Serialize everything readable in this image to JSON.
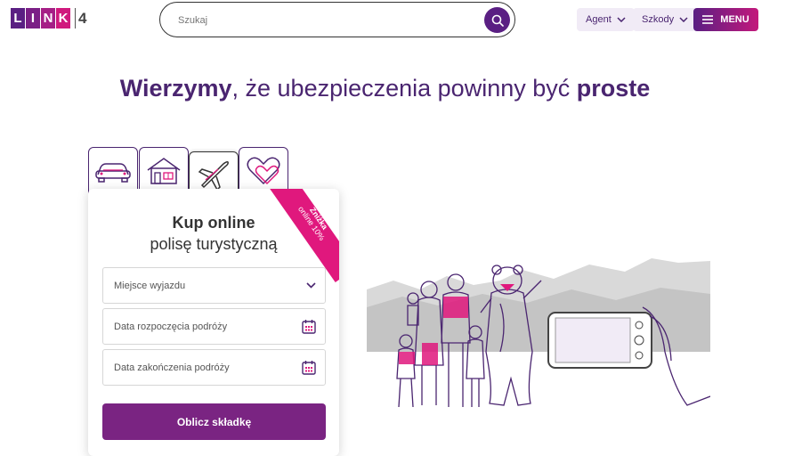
{
  "logo": {
    "letters": [
      "L",
      "I",
      "N",
      "K"
    ],
    "number": "4"
  },
  "search": {
    "placeholder": "Szukaj"
  },
  "header": {
    "agent_label": "Agent",
    "szkody_label": "Szkody",
    "menu_label": "MENU"
  },
  "headline": {
    "part1": "Wierzymy",
    "part2": ", że ubezpieczenia powinny być ",
    "part3": "proste"
  },
  "tabs": [
    {
      "icon": "car-icon",
      "active": false
    },
    {
      "icon": "house-icon",
      "active": false
    },
    {
      "icon": "plane-icon",
      "active": true
    },
    {
      "icon": "heart-icon",
      "active": false
    }
  ],
  "card": {
    "ribbon_line1": "Zniżka",
    "ribbon_line2": "online 10%",
    "title": "Kup online",
    "subtitle": "polisę turystyczną",
    "destination_placeholder": "Miejsce wyjazdu",
    "start_date_placeholder": "Data rozpoczęcia podróży",
    "end_date_placeholder": "Data zakończenia podróży",
    "submit_label": "Oblicz składkę"
  },
  "colors": {
    "brand_purple": "#5a1f83",
    "brand_pink": "#e0187d",
    "button_purple": "#7a2482"
  }
}
